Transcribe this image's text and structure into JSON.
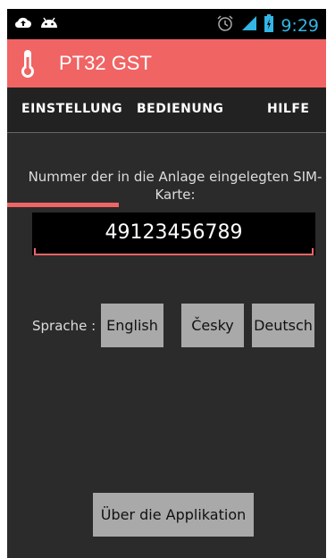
{
  "status_bar": {
    "time": "9:29"
  },
  "app": {
    "title": "PT32 GST"
  },
  "tabs": [
    {
      "label": "EINSTELLUNG",
      "active": true
    },
    {
      "label": "BEDIENUNG",
      "active": false
    },
    {
      "label": "HILFE",
      "active": false
    }
  ],
  "settings": {
    "sim_label": "Nummer der in die Anlage eingelegten SIM-Karte:",
    "sim_number": "49123456789",
    "language_label": "Sprache :",
    "languages": [
      "English",
      "Česky",
      "Deutsch"
    ],
    "about_button": "Über die Applikation"
  },
  "colors": {
    "accent": "#f06464",
    "background": "#2b2b2b",
    "status_icons": "#33b5e5",
    "button": "#a9a9a9"
  }
}
